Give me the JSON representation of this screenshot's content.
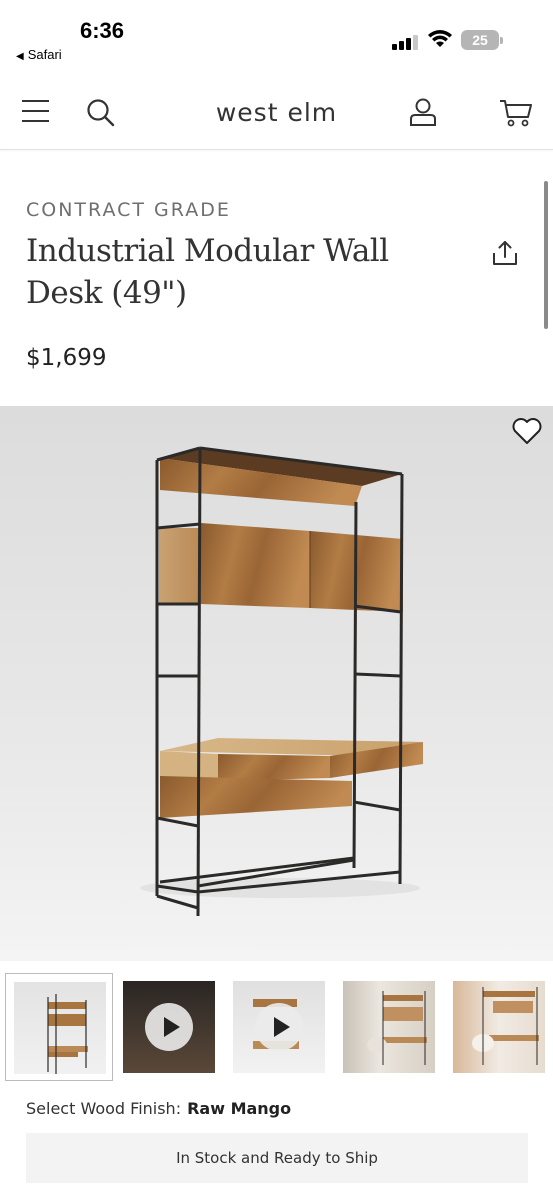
{
  "status_bar": {
    "time": "6:36",
    "back_app": "Safari",
    "battery": "25"
  },
  "header": {
    "brand": "west elm",
    "icons": [
      "menu-icon",
      "search-icon",
      "account-icon",
      "cart-icon"
    ]
  },
  "product": {
    "eyebrow": "CONTRACT GRADE",
    "title": "Industrial Modular Wall Desk (49\")",
    "price": "$1,699",
    "finish_label": "Select Wood Finish:",
    "finish_value": "Raw Mango",
    "stock_status": "In Stock and Ready to Ship"
  },
  "thumbnails": [
    {
      "kind": "image",
      "selected": true
    },
    {
      "kind": "video",
      "selected": false
    },
    {
      "kind": "video",
      "selected": false
    },
    {
      "kind": "image",
      "selected": false
    },
    {
      "kind": "image",
      "selected": false
    }
  ],
  "colors": {
    "wood": "#a8743f",
    "frame": "#2b2a28",
    "accent_text": "#333333",
    "stock_bg": "#f3f3f3"
  }
}
